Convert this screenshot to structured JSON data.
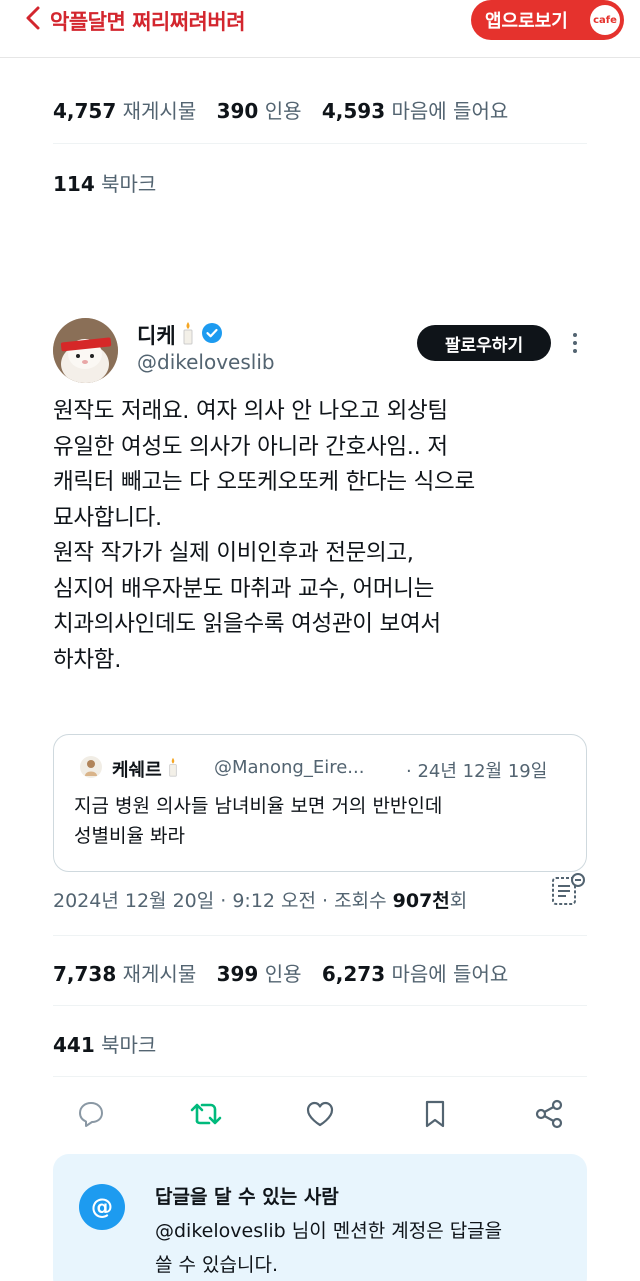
{
  "header": {
    "back_icon": "chevron-left-icon",
    "cafe_title": "악플달면 쩌리쩌려버려",
    "app_button_label": "앱으로보기",
    "cafe_badge": "cafe",
    "accent_color": "#e5322d"
  },
  "prev_tweet_stats": {
    "retweets_count": "4,757",
    "retweets_label": "재게시물",
    "quotes_count": "390",
    "quotes_label": "인용",
    "likes_count": "4,593",
    "likes_label": "마음에 들어요",
    "bookmarks_count": "114",
    "bookmarks_label": "북마크"
  },
  "tweet": {
    "display_name": "디케",
    "name_emoji": "candle-icon",
    "verified_icon": "verified-badge-icon",
    "handle": "@dikeloveslib",
    "follow_label": "팔로우하기",
    "more_icon": "more-vertical-icon",
    "text_lines": [
      "원작도 저래요. 여자 의사 안 나오고 외상팀",
      "유일한 여성도 의사가 아니라 간호사임.. 저",
      "캐릭터 빼고는 다 오또케오또케 한다는 식으로",
      "묘사합니다.",
      "원작 작가가 실제 이비인후과 전문의고,",
      "심지어 배우자분도 마취과 교수, 어머니는",
      "치과의사인데도 읽을수록 여성관이 보여서",
      "하차함."
    ],
    "quote": {
      "name": "케쉐르",
      "handle": "@Manong_Eire...",
      "date": "· 24년 12월 19일",
      "text_lines": [
        "지금 병원 의사들 남녀비율 보면 거의 반반인데",
        "성별비율 봐라"
      ]
    },
    "meta": {
      "timestamp": "2024년 12월 20일 · 9:12 오전 · 조회수",
      "views": "907천",
      "views_suffix": "회"
    },
    "stats": {
      "retweets_count": "7,738",
      "retweets_label": "재게시물",
      "quotes_count": "399",
      "quotes_label": "인용",
      "likes_count": "6,273",
      "likes_label": "마음에 들어요",
      "bookmarks_count": "441",
      "bookmarks_label": "북마크"
    },
    "actions": [
      "reply-icon",
      "retweet-icon",
      "like-icon",
      "bookmark-icon",
      "share-icon"
    ],
    "retweet_color": "#00ba7c"
  },
  "reply_permission": {
    "icon": "at-icon",
    "at_glyph": "@",
    "title": "답글을 달 수 있는 사람",
    "desc_line1": "@dikeloveslib 님이 멘션한 계정은 답글을",
    "desc_line2": "쓸 수 있습니다."
  }
}
